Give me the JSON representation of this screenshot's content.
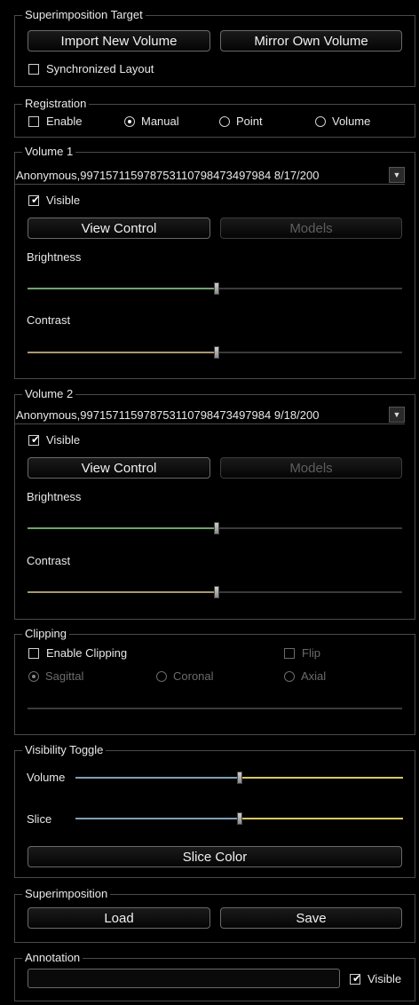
{
  "superimposition_target": {
    "title": "Superimposition Target",
    "import_button": "Import New Volume",
    "mirror_button": "Mirror Own Volume",
    "sync_layout_label": "Synchronized Layout",
    "sync_layout_checked": false
  },
  "registration": {
    "title": "Registration",
    "enable_label": "Enable",
    "enable_checked": false,
    "options": [
      "Manual",
      "Point",
      "Volume"
    ],
    "selected": "Manual"
  },
  "volume1": {
    "title": "Volume 1",
    "selected_volume": "Anonymous,99715711597875311079847349798​4  8/17/200",
    "visible_label": "Visible",
    "visible_checked": true,
    "view_control_button": "View Control",
    "models_button": "Models",
    "brightness_label": "Brightness",
    "brightness_value": 0.5,
    "contrast_label": "Contrast",
    "contrast_value": 0.5
  },
  "volume2": {
    "title": "Volume 2",
    "selected_volume": "Anonymous,99715711597875311079847349798​4  9/18/200",
    "visible_label": "Visible",
    "visible_checked": true,
    "view_control_button": "View Control",
    "models_button": "Models",
    "brightness_label": "Brightness",
    "brightness_value": 0.5,
    "contrast_label": "Contrast",
    "contrast_value": 0.5
  },
  "clipping": {
    "title": "Clipping",
    "enable_label": "Enable Clipping",
    "enable_checked": false,
    "flip_label": "Flip",
    "flip_checked": false,
    "options": [
      "Sagittal",
      "Coronal",
      "Axial"
    ],
    "selected": "Sagittal"
  },
  "visibility_toggle": {
    "title": "Visibility Toggle",
    "volume_label": "Volume",
    "volume_value": 0.5,
    "slice_label": "Slice",
    "slice_value": 0.5,
    "slice_color_button": "Slice Color"
  },
  "superimposition": {
    "title": "Superimposition",
    "load_button": "Load",
    "save_button": "Save"
  },
  "annotation": {
    "title": "Annotation",
    "value": "",
    "visible_label": "Visible",
    "visible_checked": true
  },
  "colors": {
    "brightness_fill": "#6fa36a",
    "contrast_fill": "#a9986a",
    "volume_left": "#7f9fb5",
    "volume_right": "#d9c95e"
  },
  "icons": {
    "check": "check-icon",
    "dropdown": "chevron-down-icon"
  }
}
